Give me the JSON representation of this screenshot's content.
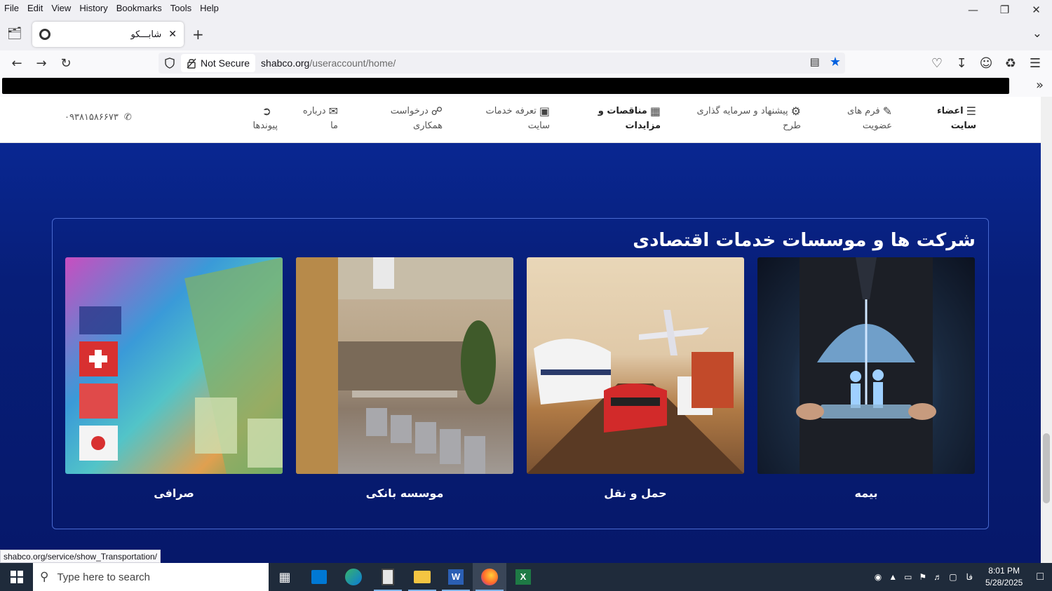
{
  "menubar": {
    "items": [
      "File",
      "Edit",
      "View",
      "History",
      "Bookmarks",
      "Tools",
      "Help"
    ]
  },
  "tab": {
    "title": "شابـــکو",
    "close": "✕"
  },
  "nav": {
    "security_label": "Not Secure",
    "url_host": "shabco.org",
    "url_path": "/useraccount/home/"
  },
  "site_nav": {
    "items": [
      {
        "line1": "اعضاء",
        "line2": "سایت",
        "icon": "menu-icon"
      },
      {
        "line1": "فرم های",
        "line2": "عضویت",
        "icon": "edit-icon"
      },
      {
        "line1": "پیشنهاد و سرمایه گذاری",
        "line2": "طرح",
        "icon": "gears-icon"
      },
      {
        "line1": "مناقصات و",
        "line2": "مزایدات",
        "icon": "card-icon"
      },
      {
        "line1": "تعرفه خدمات",
        "line2": "سایت",
        "icon": "money-icon"
      },
      {
        "line1": "درخواست",
        "line2": "همکاری",
        "icon": "handshake-icon"
      },
      {
        "line1": "درباره",
        "line2": "ما",
        "icon": "chat-icon"
      },
      {
        "line1": "",
        "line2": "پیوندها",
        "icon": "share-icon"
      }
    ],
    "phone": "۰۹۳۸۱۵۸۶۶۷۳"
  },
  "section": {
    "title": "شرکت ها و موسسات خدمات اقتصادی",
    "cards": [
      {
        "caption": "بیمه"
      },
      {
        "caption": "حمل و نقل"
      },
      {
        "caption": "موسسه بانکی"
      },
      {
        "caption": "صرافی"
      }
    ]
  },
  "status_url": "shabco.org/service/show_Transportation/",
  "taskbar": {
    "search_placeholder": "Type here to search",
    "time": "8:01 PM",
    "date": "5/28/2025",
    "lang": "فا"
  }
}
